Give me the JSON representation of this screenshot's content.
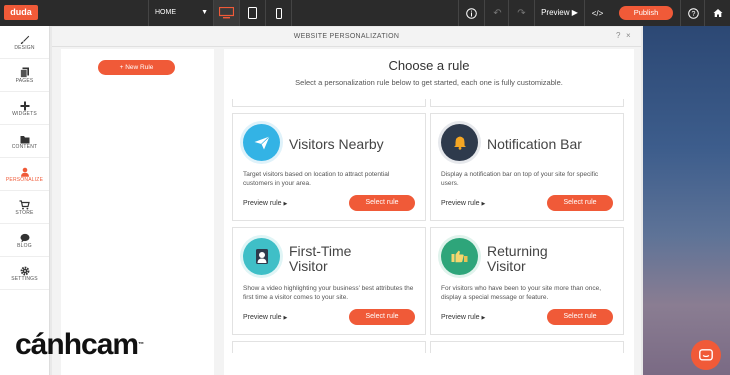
{
  "topbar": {
    "logo": "duda",
    "page_select": "HOME",
    "preview_label": "Preview",
    "publish_label": "Publish"
  },
  "sidebar": {
    "items": [
      {
        "label": "DESIGN",
        "icon": "brush-icon"
      },
      {
        "label": "PAGES",
        "icon": "pages-icon"
      },
      {
        "label": "WIDGETS",
        "icon": "plus-icon"
      },
      {
        "label": "CONTENT",
        "icon": "folder-icon"
      },
      {
        "label": "PERSONALIZE",
        "icon": "person-icon",
        "active": true
      },
      {
        "label": "STORE",
        "icon": "cart-icon"
      },
      {
        "label": "BLOG",
        "icon": "chat-bubble-icon"
      },
      {
        "label": "SETTINGS",
        "icon": "gear-icon"
      }
    ]
  },
  "modal": {
    "title": "WEBSITE PERSONALIZATION",
    "help": "?",
    "close": "×",
    "new_rule": "New Rule",
    "heading": "Choose a rule",
    "subheading": "Select a personalization rule below to get started, each one is fully customizable.",
    "preview_rule_label": "Preview rule",
    "select_rule_label": "Select rule",
    "cards": [
      {
        "title1": "Visitors Nearby",
        "title2": "",
        "desc": "Target visitors based on location to attract potential customers in your area.",
        "icon": "paper-plane-icon",
        "color": "#33b3e5"
      },
      {
        "title1": "Notification Bar",
        "title2": "",
        "desc": "Display a notification bar on top of your site for specific users.",
        "icon": "bell-icon",
        "color": "#2e3a4c"
      },
      {
        "title1": "First-Time",
        "title2": "Visitor",
        "desc": "Show a video highlighting your business' best attributes the first time a visitor comes to your site.",
        "icon": "visitor-icon",
        "color": "#3fbfc7"
      },
      {
        "title1": "Returning",
        "title2": "Visitor",
        "desc": "For visitors who have been to your site more than once, display a special message or feature.",
        "icon": "thumbs-up-icon",
        "color": "#2ea57a"
      }
    ]
  },
  "brand": "cánhcam",
  "colors": {
    "accent": "#f05a38",
    "topbar": "#2b2b2b"
  }
}
